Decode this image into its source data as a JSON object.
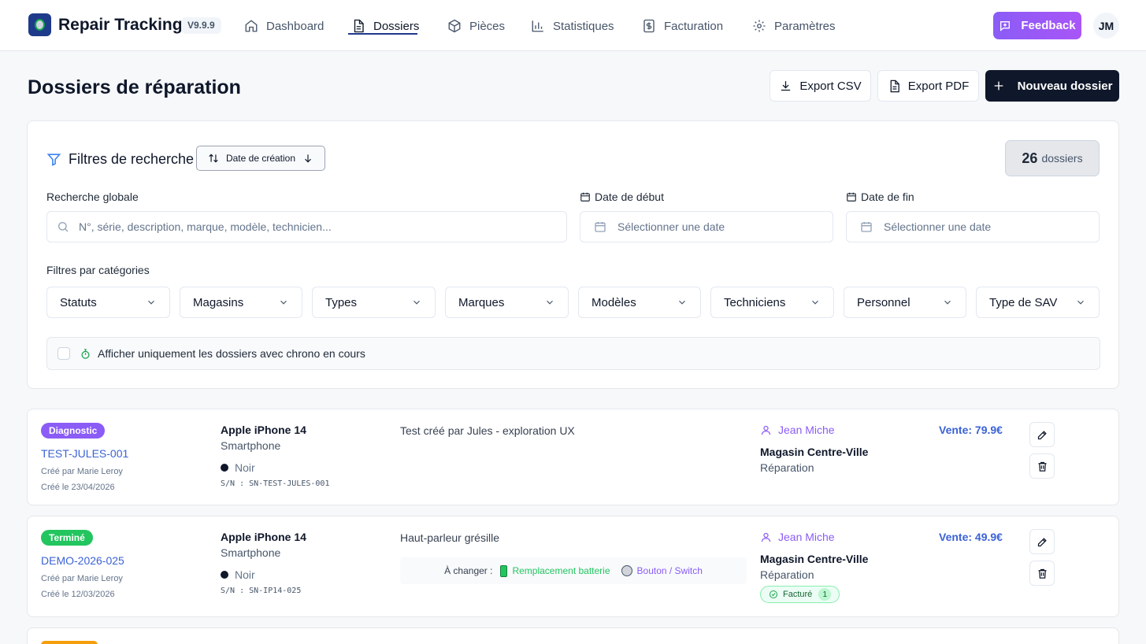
{
  "header": {
    "brand": "Repair Tracking",
    "version": "V9.9.9",
    "nav": [
      {
        "label": "Dashboard",
        "icon": "home-icon"
      },
      {
        "label": "Dossiers",
        "icon": "file-icon",
        "active": true
      },
      {
        "label": "Pièces",
        "icon": "box-icon"
      },
      {
        "label": "Statistiques",
        "icon": "bar-chart-icon"
      },
      {
        "label": "Facturation",
        "icon": "invoice-icon"
      },
      {
        "label": "Paramètres",
        "icon": "gear-icon"
      }
    ],
    "feedback_label": "Feedback",
    "avatar_initials": "JM"
  },
  "page": {
    "title": "Dossiers de réparation",
    "export_csv": "Export CSV",
    "export_pdf": "Export PDF",
    "new_dossier": "Nouveau dossier"
  },
  "filters": {
    "title": "Filtres de recherche",
    "sort_label": "Date de création",
    "count_value": "26",
    "count_label": "dossiers",
    "global_search_label": "Recherche globale",
    "global_search_placeholder": "N°, série, description, marque, modèle, technicien...",
    "start_date_label": "Date de début",
    "start_date_placeholder": "Sélectionner une date",
    "end_date_label": "Date de fin",
    "end_date_placeholder": "Sélectionner une date",
    "categories_label": "Filtres par catégories",
    "categories": [
      "Statuts",
      "Magasins",
      "Types",
      "Marques",
      "Modèles",
      "Techniciens",
      "Personnel",
      "Type de SAV"
    ],
    "chrono_label": "Afficher uniquement les dossiers avec chrono en cours"
  },
  "dossiers": [
    {
      "status": "Diagnostic",
      "status_color": "#8b5cf6",
      "ref": "TEST-JULES-001",
      "created_by": "Créé par Marie Leroy",
      "created_on": "Créé le 23/04/2026",
      "device": "Apple iPhone 14",
      "device_type": "Smartphone",
      "color": "Noir",
      "serial": "S/N : SN-TEST-JULES-001",
      "description": "Test créé par Jules - exploration UX",
      "technician": "Jean Miche",
      "store": "Magasin Centre-Ville",
      "service": "Réparation",
      "price": "Vente: 79.9€"
    },
    {
      "status": "Terminé",
      "status_color": "#22c55e",
      "ref": "DEMO-2026-025",
      "created_by": "Créé par Marie Leroy",
      "created_on": "Créé le 12/03/2026",
      "device": "Apple iPhone 14",
      "device_type": "Smartphone",
      "color": "Noir",
      "serial": "S/N : SN-IP14-025",
      "description": "Haut-parleur grésille",
      "parts_label": "À changer :",
      "part1": "Remplacement batterie",
      "part2": "Bouton / Switch",
      "technician": "Jean Miche",
      "store": "Magasin Centre-Ville",
      "service": "Réparation",
      "billed_label": "Facturé",
      "billed_count": "1",
      "price": "Vente: 49.9€"
    }
  ]
}
